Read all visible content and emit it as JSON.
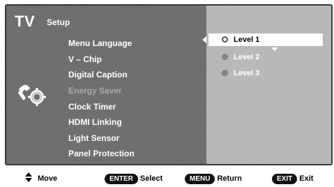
{
  "header": {
    "title": "TV",
    "subtitle": "Setup"
  },
  "menu": {
    "items": [
      {
        "label": "Menu Language",
        "state": "selected"
      },
      {
        "label": "V – Chip",
        "state": "normal"
      },
      {
        "label": "Digital Caption",
        "state": "normal"
      },
      {
        "label": "Energy Saver",
        "state": "disabled"
      },
      {
        "label": "Clock Timer",
        "state": "normal"
      },
      {
        "label": "HDMI Linking",
        "state": "normal"
      },
      {
        "label": "Light Sensor",
        "state": "normal"
      },
      {
        "label": "Panel Protection",
        "state": "normal"
      }
    ]
  },
  "submenu": {
    "options": [
      {
        "label": "Level 1",
        "selected": true
      },
      {
        "label": "Level 2",
        "selected": false
      },
      {
        "label": "Level 3",
        "selected": false
      }
    ]
  },
  "footer": {
    "move_label": "Move",
    "enter_key": "ENTER",
    "enter_label": "Select",
    "menu_key": "MENU",
    "menu_label": "Return",
    "exit_key": "EXIT",
    "exit_label": "Exit"
  },
  "icons": {
    "setup": "setup-gear-icon",
    "left": "left-arrow-icon",
    "down": "down-arrow-icon",
    "move": "up-down-arrow-icon"
  },
  "colors": {
    "panel_dark": "#6e6e6e",
    "panel_light": "#b8b8b8",
    "highlight": "#ffffff",
    "key_bg": "#111111"
  }
}
